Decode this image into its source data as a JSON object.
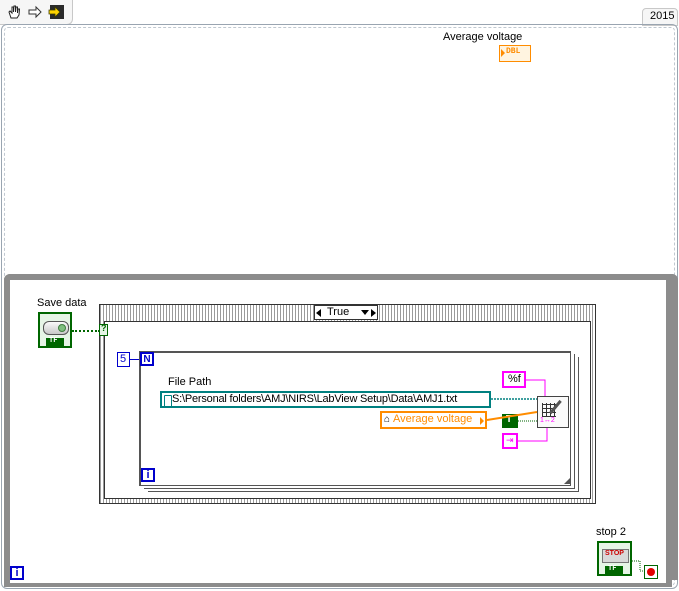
{
  "toolbar": {
    "icons": [
      "hand-operate-icon",
      "arrow-run-icon",
      "highlight-execution-icon"
    ]
  },
  "version_label": "2015",
  "average_voltage_indicator": {
    "label": "Average voltage",
    "type_badge": "DBL"
  },
  "save_data_control": {
    "label": "Save data",
    "tf_badge": "TF"
  },
  "case_structure": {
    "selector_value": "True",
    "selector_terminal": "?"
  },
  "for_loop": {
    "count_constant": "5",
    "count_terminal": "N",
    "iteration_terminal": "i"
  },
  "file_path": {
    "label": "File Path",
    "value": "S:\\Personal folders\\AMJ\\NIRS\\LabView Setup\\Data\\AMJ1.txt"
  },
  "local_variable": {
    "label": "Average voltage"
  },
  "format_constant": "%f",
  "true_constant": "T",
  "write_function": {
    "icon": "write-delimited-spreadsheet-icon",
    "label": "1↔2"
  },
  "while_loop": {
    "iteration_terminal": "i"
  },
  "stop_button": {
    "label": "stop 2",
    "text": "STOP",
    "tf_badge": "TF"
  },
  "colors": {
    "orange": "#ff8c00",
    "pink": "#ff00ff",
    "green": "#006600",
    "blue": "#0000cc",
    "teal": "#008080",
    "gray_frame": "#808080"
  }
}
